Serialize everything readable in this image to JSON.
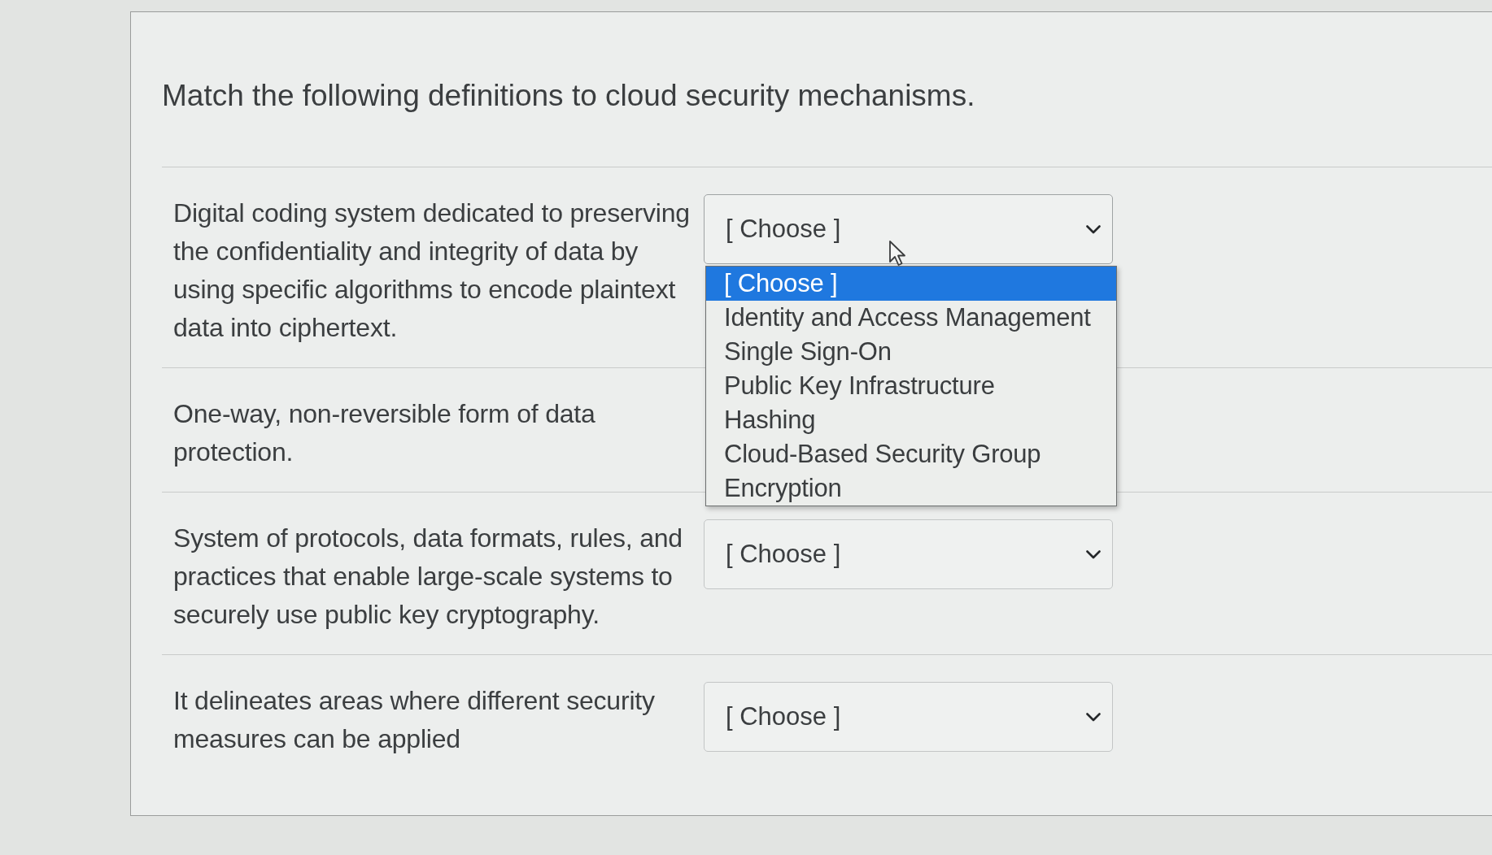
{
  "question": {
    "prompt": "Match the following definitions to cloud security mechanisms."
  },
  "rows": [
    {
      "definition": "Digital coding system dedicated to preserving the confidentiality and integrity of data by using specific algorithms to encode plaintext data into ciphertext.",
      "select": {
        "value": "[ Choose ]",
        "expanded": true,
        "options": [
          {
            "label": "[ Choose ]",
            "selected": true
          },
          {
            "label": "Identity and Access Management",
            "selected": false
          },
          {
            "label": "Single Sign-On",
            "selected": false
          },
          {
            "label": "Public Key Infrastructure",
            "selected": false
          },
          {
            "label": "Hashing",
            "selected": false
          },
          {
            "label": "Cloud-Based Security Group",
            "selected": false
          },
          {
            "label": "Encryption",
            "selected": false
          }
        ]
      }
    },
    {
      "definition": "One-way, non-reversible form of data protection."
    },
    {
      "definition": "System of protocols, data formats, rules, and practices that enable large-scale systems to securely use public key cryptography.",
      "select": {
        "value": "[ Choose ]",
        "expanded": false
      }
    },
    {
      "definition": "It delineates areas where different security measures can be applied",
      "select": {
        "value": "[ Choose ]",
        "expanded": false
      }
    }
  ]
}
